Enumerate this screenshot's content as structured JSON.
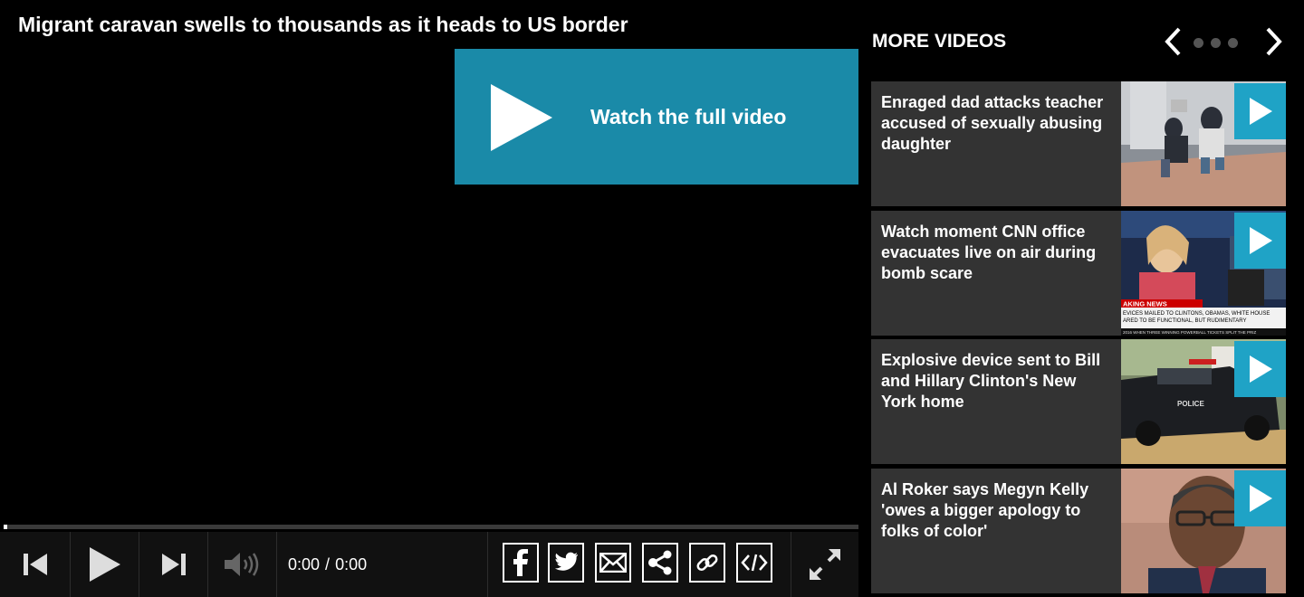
{
  "player": {
    "title": "Migrant caravan swells to thousands as it heads to US border",
    "watch_full_label": "Watch the full video",
    "progress": 0.0,
    "time_current": "0:00",
    "time_separator": "/",
    "time_total": "0:00",
    "accent_color": "#1a8aa8"
  },
  "controls": {
    "icons": [
      "previous-icon",
      "play-icon",
      "next-icon",
      "volume-icon"
    ],
    "share_icons": [
      "facebook-icon",
      "twitter-icon",
      "email-icon",
      "share-icon",
      "link-icon",
      "embed-icon"
    ],
    "fullscreen_icon": "expand-icon"
  },
  "sidebar": {
    "heading": "MORE VIDEOS",
    "page_dots": 3,
    "cards": [
      {
        "title": "Enraged dad attacks teacher accused of sexually abusing daughter"
      },
      {
        "title": "Watch moment CNN office evacuates live on air during bomb scare",
        "thumb_banner": "AKING NEWS",
        "thumb_ticker1": "EVICES MAILED TO CLINTONS, OBAMAS, WHITE HOUSE",
        "thumb_ticker2": "ARED TO BE FUNCTIONAL, BUT RUDIMENTARY",
        "thumb_ticker3": "2016 WHEN THREE WINNING POWERBALL TICKETS SPLIT THE PRIZ"
      },
      {
        "title": "Explosive device sent to Bill and Hillary Clinton's New York home",
        "thumb_car_label": "POLICE"
      },
      {
        "title": "Al Roker says Megyn Kelly 'owes a bigger apology to folks of color'"
      }
    ],
    "play_badge_color": "#1fa3c6"
  }
}
